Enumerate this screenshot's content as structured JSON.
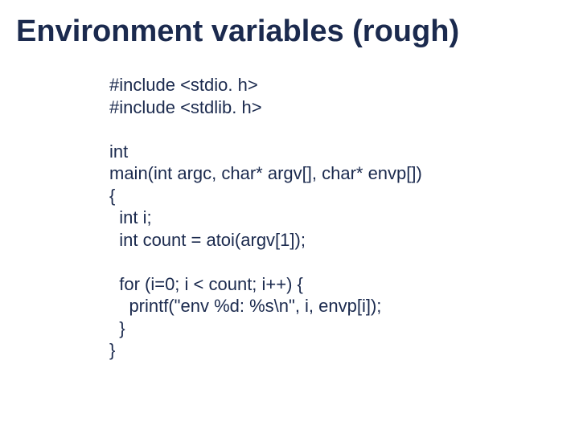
{
  "slide": {
    "title": "Environment variables (rough)",
    "code": "#include <stdio. h>\n#include <stdlib. h>\n\nint\nmain(int argc, char* argv[], char* envp[])\n{\n  int i;\n  int count = atoi(argv[1]);\n\n  for (i=0; i < count; i++) {\n    printf(\"env %d: %s\\n\", i, envp[i]);\n  }\n}"
  }
}
